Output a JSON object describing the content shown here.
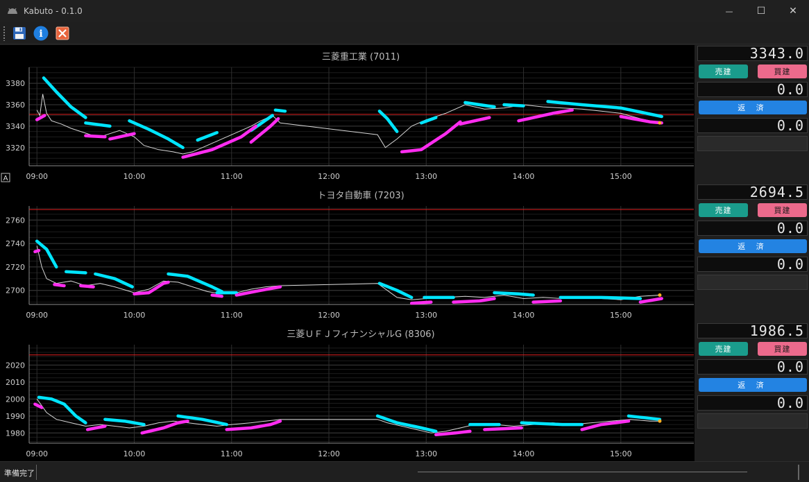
{
  "window": {
    "title": "Kabuto - 0.1.0",
    "icon": "kabuto-helmet-icon",
    "controls": {
      "minimize": "—",
      "maximize": "☐",
      "close": "✕"
    }
  },
  "toolbar": {
    "buttons": [
      {
        "id": "save",
        "icon": "floppy-disk-icon"
      },
      {
        "id": "info",
        "icon": "info-icon",
        "glyph": "i"
      },
      {
        "id": "close",
        "icon": "close-box-icon",
        "glyph": "✕"
      }
    ]
  },
  "colors": {
    "sell": "#1a9c8c",
    "buy": "#ec6a8c",
    "repay": "#2383e2",
    "trend_up": "#00e5ff",
    "trend_down": "#ff2cf0",
    "price_line": "#d8d8d8",
    "limit_line": "#e02020"
  },
  "auto_marker": "A",
  "chart_data": [
    {
      "type": "line",
      "title": "三菱重工業 (7011)",
      "x_ticks": [
        "09:00",
        "10:00",
        "11:00",
        "12:00",
        "13:00",
        "14:00",
        "15:00"
      ],
      "x_range": [
        8.92,
        15.75
      ],
      "ylim": [
        3303,
        3395
      ],
      "y_ticks": [
        3320,
        3340,
        3360,
        3380
      ],
      "grid": true,
      "ref_line": 3351,
      "price": [
        [
          9.0,
          3355
        ],
        [
          9.03,
          3350
        ],
        [
          9.06,
          3370
        ],
        [
          9.1,
          3352
        ],
        [
          9.15,
          3345
        ],
        [
          9.25,
          3342
        ],
        [
          9.35,
          3338
        ],
        [
          9.45,
          3335
        ],
        [
          9.55,
          3332
        ],
        [
          9.65,
          3330
        ],
        [
          9.75,
          3333
        ],
        [
          9.85,
          3336
        ],
        [
          10.0,
          3330
        ],
        [
          10.1,
          3322
        ],
        [
          10.25,
          3318
        ],
        [
          10.4,
          3316
        ],
        [
          10.5,
          3314
        ],
        [
          10.6,
          3316
        ],
        [
          10.75,
          3322
        ],
        [
          10.9,
          3328
        ],
        [
          11.05,
          3334
        ],
        [
          11.2,
          3340
        ],
        [
          11.3,
          3345
        ],
        [
          11.42,
          3350
        ],
        [
          11.5,
          3343
        ],
        [
          12.5,
          3332
        ],
        [
          12.58,
          3320
        ],
        [
          12.7,
          3328
        ],
        [
          12.85,
          3340
        ],
        [
          13.0,
          3346
        ],
        [
          13.2,
          3352
        ],
        [
          13.4,
          3360
        ],
        [
          13.6,
          3356
        ],
        [
          13.8,
          3357
        ],
        [
          14.0,
          3360
        ],
        [
          14.2,
          3358
        ],
        [
          14.4,
          3357
        ],
        [
          14.6,
          3356
        ],
        [
          14.8,
          3354
        ],
        [
          15.0,
          3352
        ],
        [
          15.2,
          3347
        ],
        [
          15.4,
          3343
        ]
      ],
      "trend_up": [
        [
          [
            9.07,
            3385
          ],
          [
            9.2,
            3372
          ],
          [
            9.35,
            3358
          ],
          [
            9.5,
            3348
          ]
        ],
        [
          [
            9.5,
            3343
          ],
          [
            9.75,
            3340
          ]
        ],
        [
          [
            9.95,
            3345
          ],
          [
            10.15,
            3337
          ],
          [
            10.35,
            3328
          ],
          [
            10.5,
            3320
          ]
        ],
        [
          [
            10.65,
            3327
          ],
          [
            10.85,
            3334
          ]
        ],
        [
          [
            11.2,
            3336
          ],
          [
            11.42,
            3350
          ]
        ],
        [
          [
            11.45,
            3355
          ],
          [
            11.55,
            3354
          ]
        ],
        [
          [
            12.52,
            3354
          ],
          [
            12.6,
            3347
          ],
          [
            12.7,
            3335
          ]
        ],
        [
          [
            12.95,
            3343
          ],
          [
            13.1,
            3348
          ]
        ],
        [
          [
            13.4,
            3362
          ],
          [
            13.7,
            3358
          ]
        ],
        [
          [
            13.8,
            3360
          ],
          [
            14.0,
            3359
          ]
        ],
        [
          [
            14.25,
            3363
          ],
          [
            14.6,
            3360
          ],
          [
            15.0,
            3357
          ],
          [
            15.42,
            3349
          ]
        ]
      ],
      "trend_down": [
        [
          [
            9.0,
            3346
          ],
          [
            9.08,
            3350
          ]
        ],
        [
          [
            9.5,
            3331
          ],
          [
            9.7,
            3330
          ]
        ],
        [
          [
            9.75,
            3328
          ],
          [
            10.0,
            3333
          ]
        ],
        [
          [
            10.5,
            3311
          ],
          [
            10.8,
            3318
          ],
          [
            11.1,
            3330
          ],
          [
            11.25,
            3340
          ]
        ],
        [
          [
            11.2,
            3325
          ],
          [
            11.4,
            3340
          ],
          [
            11.48,
            3347
          ]
        ],
        [
          [
            12.75,
            3316
          ],
          [
            12.95,
            3318
          ],
          [
            13.2,
            3333
          ],
          [
            13.35,
            3344
          ]
        ],
        [
          [
            13.35,
            3342
          ],
          [
            13.65,
            3348
          ]
        ],
        [
          [
            13.95,
            3345
          ],
          [
            14.3,
            3352
          ],
          [
            14.5,
            3355
          ]
        ],
        [
          [
            15.0,
            3349
          ],
          [
            15.3,
            3344
          ],
          [
            15.42,
            3343
          ]
        ]
      ]
    },
    {
      "type": "line",
      "title": "トヨタ自動車 (7203)",
      "x_ticks": [
        "09:00",
        "10:00",
        "11:00",
        "12:00",
        "13:00",
        "14:00",
        "15:00"
      ],
      "x_range": [
        8.92,
        15.75
      ],
      "ylim": [
        2688,
        2772
      ],
      "y_ticks": [
        2700,
        2720,
        2740,
        2760
      ],
      "grid": true,
      "ref_line": 2769,
      "price": [
        [
          9.0,
          2738
        ],
        [
          9.05,
          2720
        ],
        [
          9.1,
          2710
        ],
        [
          9.2,
          2706
        ],
        [
          9.35,
          2708
        ],
        [
          9.5,
          2704
        ],
        [
          9.65,
          2706
        ],
        [
          9.8,
          2703
        ],
        [
          10.0,
          2698
        ],
        [
          10.15,
          2701
        ],
        [
          10.3,
          2708
        ],
        [
          10.45,
          2707
        ],
        [
          10.6,
          2703
        ],
        [
          10.75,
          2699
        ],
        [
          10.9,
          2697
        ],
        [
          11.05,
          2698
        ],
        [
          11.2,
          2701
        ],
        [
          11.35,
          2703
        ],
        [
          11.5,
          2704
        ],
        [
          12.5,
          2706
        ],
        [
          12.6,
          2700
        ],
        [
          12.7,
          2694
        ],
        [
          12.85,
          2692
        ],
        [
          13.0,
          2693
        ],
        [
          13.2,
          2694
        ],
        [
          13.4,
          2695
        ],
        [
          13.6,
          2694
        ],
        [
          13.8,
          2696
        ],
        [
          14.0,
          2693
        ],
        [
          14.2,
          2694
        ],
        [
          14.4,
          2693
        ],
        [
          14.6,
          2694
        ],
        [
          14.8,
          2693
        ],
        [
          15.0,
          2692
        ],
        [
          15.2,
          2695
        ],
        [
          15.4,
          2696
        ]
      ],
      "trend_up": [
        [
          [
            9.0,
            2742
          ],
          [
            9.1,
            2735
          ],
          [
            9.2,
            2720
          ]
        ],
        [
          [
            9.3,
            2716
          ],
          [
            9.5,
            2715
          ]
        ],
        [
          [
            9.6,
            2714
          ],
          [
            9.8,
            2710
          ],
          [
            9.98,
            2703
          ]
        ],
        [
          [
            10.35,
            2714
          ],
          [
            10.55,
            2712
          ],
          [
            10.8,
            2703
          ],
          [
            10.9,
            2699
          ]
        ],
        [
          [
            10.85,
            2698
          ],
          [
            11.05,
            2698
          ]
        ],
        [
          [
            12.52,
            2706
          ],
          [
            12.7,
            2700
          ],
          [
            12.85,
            2694
          ]
        ],
        [
          [
            12.98,
            2694
          ],
          [
            13.28,
            2694
          ]
        ],
        [
          [
            13.7,
            2698
          ],
          [
            13.95,
            2697
          ],
          [
            14.1,
            2696
          ]
        ],
        [
          [
            14.38,
            2694
          ],
          [
            14.8,
            2694
          ],
          [
            15.2,
            2693
          ]
        ]
      ],
      "trend_down": [
        [
          [
            8.98,
            2733
          ],
          [
            9.02,
            2734
          ]
        ],
        [
          [
            9.18,
            2705
          ],
          [
            9.28,
            2704
          ]
        ],
        [
          [
            9.45,
            2704
          ],
          [
            9.58,
            2703
          ]
        ],
        [
          [
            10.0,
            2697
          ],
          [
            10.15,
            2698
          ],
          [
            10.3,
            2706
          ],
          [
            10.35,
            2707
          ]
        ],
        [
          [
            10.8,
            2696
          ],
          [
            10.9,
            2695
          ]
        ],
        [
          [
            11.05,
            2696
          ],
          [
            11.3,
            2700
          ],
          [
            11.5,
            2703
          ]
        ],
        [
          [
            12.85,
            2689
          ],
          [
            13.05,
            2690
          ]
        ],
        [
          [
            13.28,
            2690
          ],
          [
            13.55,
            2691
          ],
          [
            13.7,
            2693
          ]
        ],
        [
          [
            14.1,
            2690
          ],
          [
            14.38,
            2691
          ]
        ],
        [
          [
            15.2,
            2690
          ],
          [
            15.42,
            2693
          ]
        ]
      ]
    },
    {
      "type": "line",
      "title": "三菱ＵＦＪフィナンシャルG (8306)",
      "x_ticks": [
        "09:00",
        "10:00",
        "11:00",
        "12:00",
        "13:00",
        "14:00",
        "15:00"
      ],
      "x_range": [
        8.92,
        15.75
      ],
      "ylim": [
        1974,
        2032
      ],
      "y_ticks": [
        1980,
        1990,
        2000,
        2010,
        2020
      ],
      "grid": true,
      "ref_line": 2026,
      "price": [
        [
          9.0,
          2000
        ],
        [
          9.05,
          1996
        ],
        [
          9.1,
          1992
        ],
        [
          9.2,
          1988
        ],
        [
          9.35,
          1986
        ],
        [
          9.5,
          1984
        ],
        [
          9.65,
          1985
        ],
        [
          9.8,
          1984
        ],
        [
          9.95,
          1983
        ],
        [
          10.1,
          1984
        ],
        [
          10.25,
          1986
        ],
        [
          10.4,
          1987
        ],
        [
          10.55,
          1986
        ],
        [
          10.7,
          1985
        ],
        [
          10.85,
          1984
        ],
        [
          11.0,
          1985
        ],
        [
          11.2,
          1986
        ],
        [
          11.35,
          1987
        ],
        [
          11.5,
          1988
        ],
        [
          12.5,
          1988
        ],
        [
          12.6,
          1986
        ],
        [
          12.75,
          1984
        ],
        [
          12.9,
          1982
        ],
        [
          13.05,
          1980
        ],
        [
          13.2,
          1981
        ],
        [
          13.35,
          1983
        ],
        [
          13.5,
          1985
        ],
        [
          13.7,
          1985
        ],
        [
          13.9,
          1984
        ],
        [
          14.1,
          1985
        ],
        [
          14.3,
          1986
        ],
        [
          14.5,
          1985
        ],
        [
          14.7,
          1986
        ],
        [
          14.9,
          1987
        ],
        [
          15.1,
          1988
        ],
        [
          15.3,
          1987
        ],
        [
          15.4,
          1987
        ]
      ],
      "trend_up": [
        [
          [
            9.02,
            2001
          ],
          [
            9.15,
            2000
          ],
          [
            9.28,
            1997
          ]
        ],
        [
          [
            9.28,
            1997
          ],
          [
            9.4,
            1990
          ],
          [
            9.5,
            1986
          ]
        ],
        [
          [
            9.7,
            1988
          ],
          [
            9.9,
            1987
          ],
          [
            10.1,
            1985
          ]
        ],
        [
          [
            10.45,
            1990
          ],
          [
            10.7,
            1988
          ],
          [
            10.95,
            1985
          ]
        ],
        [
          [
            12.5,
            1990
          ],
          [
            12.7,
            1986
          ],
          [
            12.95,
            1983
          ],
          [
            13.1,
            1981
          ]
        ],
        [
          [
            13.45,
            1985
          ],
          [
            13.75,
            1985
          ]
        ],
        [
          [
            13.98,
            1986
          ],
          [
            14.4,
            1985
          ],
          [
            14.6,
            1985
          ]
        ],
        [
          [
            15.08,
            1990
          ],
          [
            15.4,
            1988
          ]
        ]
      ],
      "trend_down": [
        [
          [
            8.98,
            1997
          ],
          [
            9.05,
            1995
          ]
        ],
        [
          [
            9.52,
            1982
          ],
          [
            9.7,
            1984
          ]
        ],
        [
          [
            10.08,
            1980
          ],
          [
            10.3,
            1983
          ],
          [
            10.45,
            1986
          ],
          [
            10.55,
            1987
          ]
        ],
        [
          [
            10.95,
            1982
          ],
          [
            11.2,
            1983
          ],
          [
            11.4,
            1985
          ],
          [
            11.5,
            1987
          ]
        ],
        [
          [
            13.1,
            1979
          ],
          [
            13.3,
            1980
          ],
          [
            13.45,
            1981
          ]
        ],
        [
          [
            13.6,
            1982
          ],
          [
            13.98,
            1983
          ]
        ],
        [
          [
            14.6,
            1982
          ],
          [
            14.8,
            1985
          ],
          [
            15.08,
            1987
          ]
        ]
      ]
    }
  ],
  "tickers": [
    {
      "price": "3343.0",
      "sell_label": "売建",
      "buy_label": "買建",
      "position": "0.0",
      "repay_label": "返 済",
      "pnl": "0.0",
      "memo": ""
    },
    {
      "price": "2694.5",
      "sell_label": "売建",
      "buy_label": "買建",
      "position": "0.0",
      "repay_label": "返 済",
      "pnl": "0.0",
      "memo": ""
    },
    {
      "price": "1986.5",
      "sell_label": "売建",
      "buy_label": "買建",
      "position": "0.0",
      "repay_label": "返 済",
      "pnl": "0.0",
      "memo": ""
    }
  ],
  "status": {
    "text": "準備完了"
  }
}
